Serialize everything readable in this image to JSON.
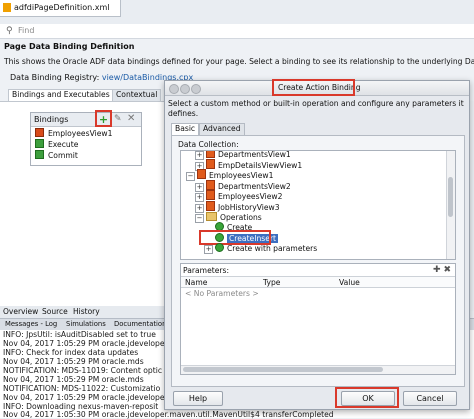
{
  "editor": {
    "file_tab": "adfdiPageDefinition.xml",
    "search_placeholder": "Find"
  },
  "page": {
    "title": "Page Data Binding Definition",
    "description": "This shows the Oracle ADF data bindings defined for your page. Select a binding to see its relationship to the underlying Data",
    "registry_label": "Data Binding Registry:",
    "registry_link": "view/DataBindings.cpx",
    "tabs": [
      "Bindings and Executables",
      "Contextual"
    ]
  },
  "bindings": {
    "header": "Bindings",
    "add_icon": "plus-icon",
    "edit_icon": "pencil-icon",
    "delete_icon": "x-icon",
    "items": [
      "EmployeesView1",
      "Execute",
      "Commit"
    ]
  },
  "bottom_tabs": [
    "Overview",
    "Source",
    "History"
  ],
  "log": {
    "tabs": [
      "Messages - Log",
      "Simulations",
      "Documentation"
    ],
    "lines": [
      "INFO: JpsUtil: isAuditDisabled set to true",
      "Nov 04, 2017 1:05:29 PM oracle.jdeveloper",
      "INFO: Check for index data updates",
      "Nov 04, 2017 1:05:29 PM oracle.mds",
      "NOTIFICATION: MDS-11019: Content optic",
      "Nov 04, 2017 1:05:29 PM oracle.mds",
      "NOTIFICATION: MDS-11022: Customizatio",
      "Nov 04, 2017 1:05:29 PM oracle.jdevelope",
      "INFO: Downloading nexus-maven-reposit",
      "Nov 04, 2017 1:05:30 PM oracle.jdeveloper.maven.util.MavenUtil$4 transferCompleted"
    ]
  },
  "dialog": {
    "title": "Create Action Binding",
    "subtitle": "Select a custom method or built-in operation and configure any parameters it defines.",
    "tabs": [
      "Basic",
      "Advanced"
    ],
    "data_collection_label": "Data Collection:",
    "tree": [
      {
        "label": "DepartmentsView1",
        "indent": 2,
        "toggle": "+",
        "icon": "iterator"
      },
      {
        "label": "EmpDetailsViewView1",
        "indent": 2,
        "toggle": "+",
        "icon": "iterator"
      },
      {
        "label": "EmployeesView1",
        "indent": 1,
        "toggle": "−",
        "icon": "iterator"
      },
      {
        "label": "DepartmentsView2",
        "indent": 2,
        "toggle": "+",
        "icon": "iterator"
      },
      {
        "label": "EmployeesView2",
        "indent": 2,
        "toggle": "+",
        "icon": "iterator"
      },
      {
        "label": "JobHistoryView3",
        "indent": 2,
        "toggle": "+",
        "icon": "iterator"
      },
      {
        "label": "Operations",
        "indent": 2,
        "toggle": "−",
        "icon": "folder"
      },
      {
        "label": "Create",
        "indent": 3,
        "toggle": "",
        "icon": "operation"
      },
      {
        "label": "CreateInsert",
        "indent": 3,
        "toggle": "",
        "icon": "operation",
        "selected": true
      },
      {
        "label": "Create with parameters",
        "indent": 3,
        "toggle": "+",
        "icon": "operation"
      }
    ],
    "parameters_label": "Parameters:",
    "param_columns": [
      "Name",
      "Type",
      "Value"
    ],
    "param_empty": "< No Parameters >",
    "help_button": "Help",
    "ok_button": "OK",
    "cancel_button": "Cancel"
  }
}
